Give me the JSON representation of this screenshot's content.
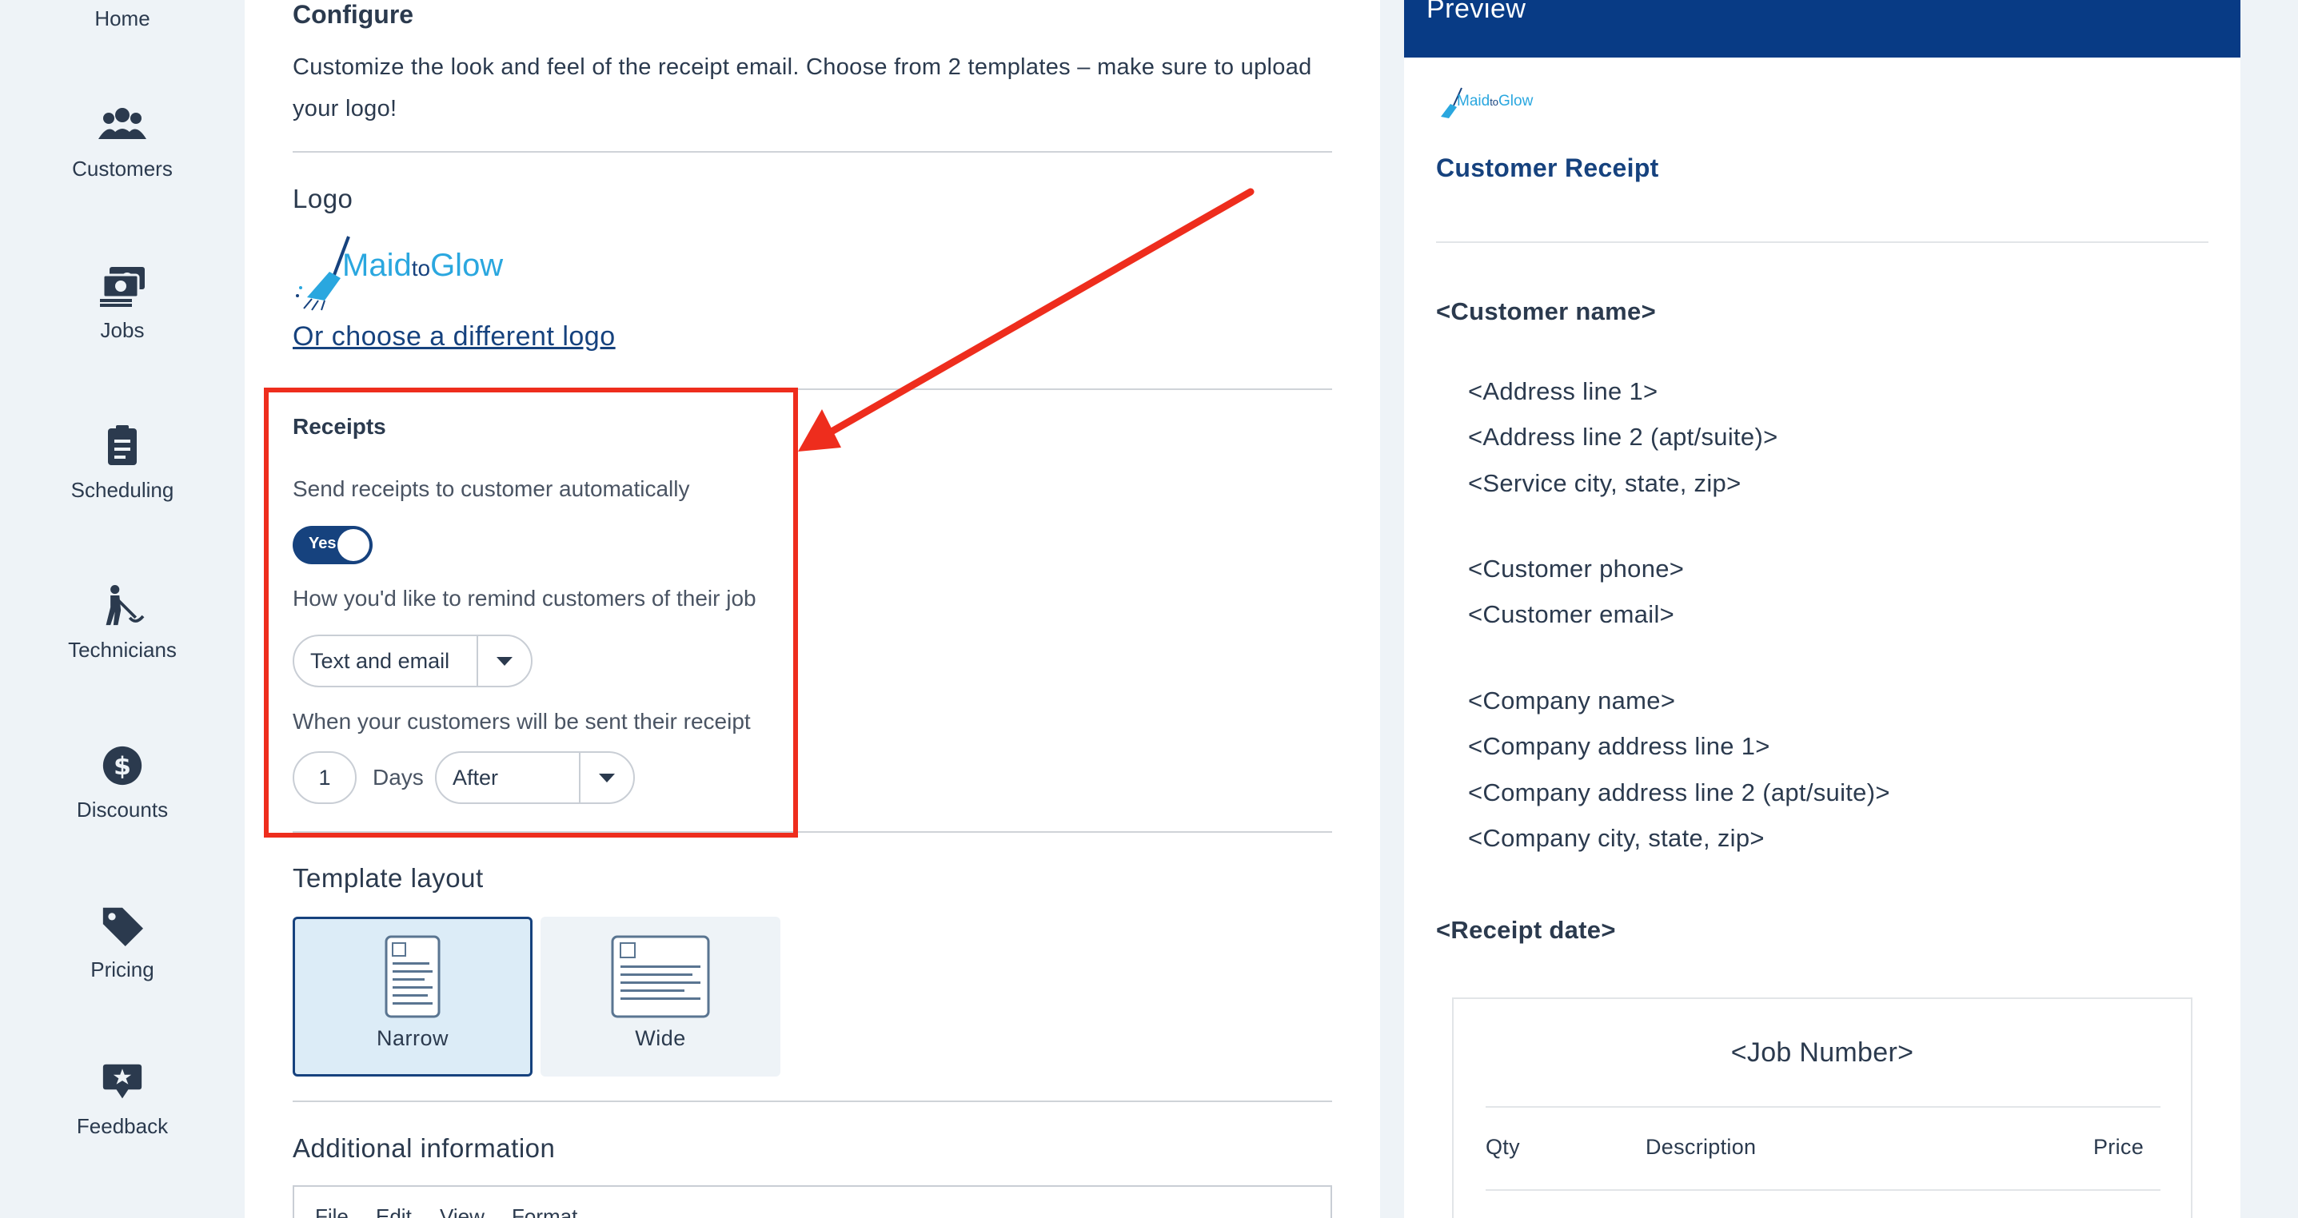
{
  "sidebar": {
    "items": [
      {
        "label": "Home",
        "icon": "home-icon"
      },
      {
        "label": "Customers",
        "icon": "users-icon"
      },
      {
        "label": "Jobs",
        "icon": "money-stack-icon"
      },
      {
        "label": "Scheduling",
        "icon": "clipboard-icon"
      },
      {
        "label": "Technicians",
        "icon": "mop-worker-icon"
      },
      {
        "label": "Discounts",
        "icon": "dollar-badge-icon"
      },
      {
        "label": "Pricing",
        "icon": "tag-icon"
      },
      {
        "label": "Feedback",
        "icon": "star-bubble-icon"
      }
    ]
  },
  "config": {
    "title": "Configure",
    "description": "Customize the look and feel of the receipt email. Choose from 2 templates – make sure to upload your logo!",
    "logo": {
      "heading": "Logo",
      "brand_main": "Maid",
      "brand_to": "to",
      "brand_end": "Glow",
      "change_link": "Or choose a different logo"
    },
    "receipts": {
      "heading": "Receipts",
      "auto_send_label": "Send receipts to customer automatically",
      "toggle_text": "Yes",
      "remind_label": "How you'd like to remind customers of their job",
      "remind_value": "Text and email",
      "timing_label": "When your customers will be sent their receipt",
      "timing_number": "1",
      "timing_unit": "Days",
      "timing_relation": "After"
    },
    "template": {
      "heading": "Template layout",
      "options": [
        "Narrow",
        "Wide"
      ],
      "selected": "Narrow"
    },
    "additional": {
      "heading": "Additional information",
      "editor_menu": [
        "File",
        "Edit",
        "View",
        "Format"
      ]
    }
  },
  "preview": {
    "title": "Preview",
    "logo_main": "Maid",
    "logo_to": "to",
    "logo_end": "Glow",
    "receipt_title": "Customer Receipt",
    "customer_name": "<Customer name>",
    "address_lines": [
      "<Address line 1>",
      "<Address line 2 (apt/suite)>",
      "<Service city, state, zip>"
    ],
    "contact_lines": [
      "<Customer phone>",
      "<Customer email>"
    ],
    "company_lines": [
      "<Company name>",
      "<Company address line 1>",
      "<Company address line 2 (apt/suite)>",
      "<Company city, state, zip>"
    ],
    "receipt_date": "<Receipt date>",
    "job_number": "<Job Number>",
    "table_headers": [
      "Qty",
      "Description",
      "Price"
    ]
  },
  "colors": {
    "brand_navy": "#16427e",
    "header_blue": "#083b85",
    "highlight_red": "#ee2d1d",
    "logo_cyan": "#2aa7df"
  }
}
